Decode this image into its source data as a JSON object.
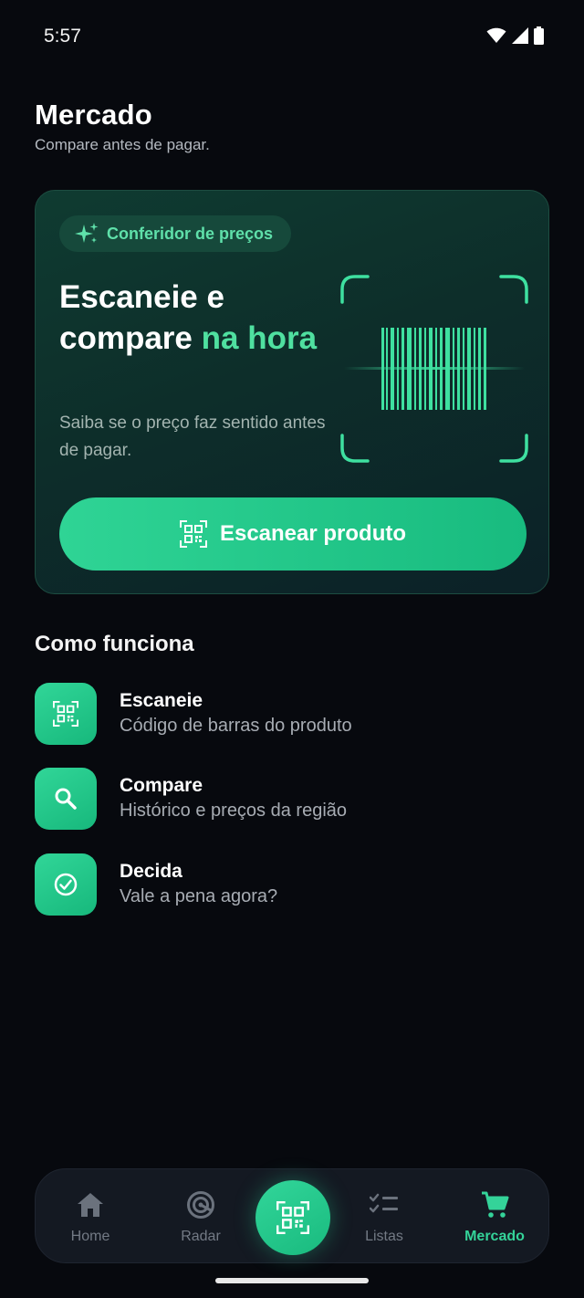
{
  "status_bar": {
    "time": "5:57"
  },
  "header": {
    "title": "Mercado",
    "subtitle": "Compare antes de pagar."
  },
  "hero": {
    "badge": "Conferidor de preços",
    "headline_1": "Escaneie e compare ",
    "headline_accent": "na hora",
    "description": "Saiba se o preço faz sentido antes de pagar.",
    "button_label": "Escanear produto"
  },
  "how_it_works": {
    "title": "Como funciona",
    "steps": [
      {
        "title": "Escaneie",
        "description": "Código de barras do produto",
        "icon": "qr-code-icon"
      },
      {
        "title": "Compare",
        "description": "Histórico e preços da região",
        "icon": "search-icon"
      },
      {
        "title": "Decida",
        "description": "Vale a pena agora?",
        "icon": "check-circle-icon"
      }
    ]
  },
  "bottom_nav": {
    "items": [
      {
        "label": "Home",
        "icon": "home-icon"
      },
      {
        "label": "Radar",
        "icon": "radar-icon"
      },
      {
        "label": "Listas",
        "icon": "checklist-icon"
      },
      {
        "label": "Mercado",
        "icon": "cart-icon"
      }
    ],
    "center_icon": "qr-scan-icon",
    "active": "Mercado"
  },
  "colors": {
    "background": "#07090e",
    "accent": "#34d399",
    "button": "#1fc489",
    "card": "#0f3b31"
  }
}
